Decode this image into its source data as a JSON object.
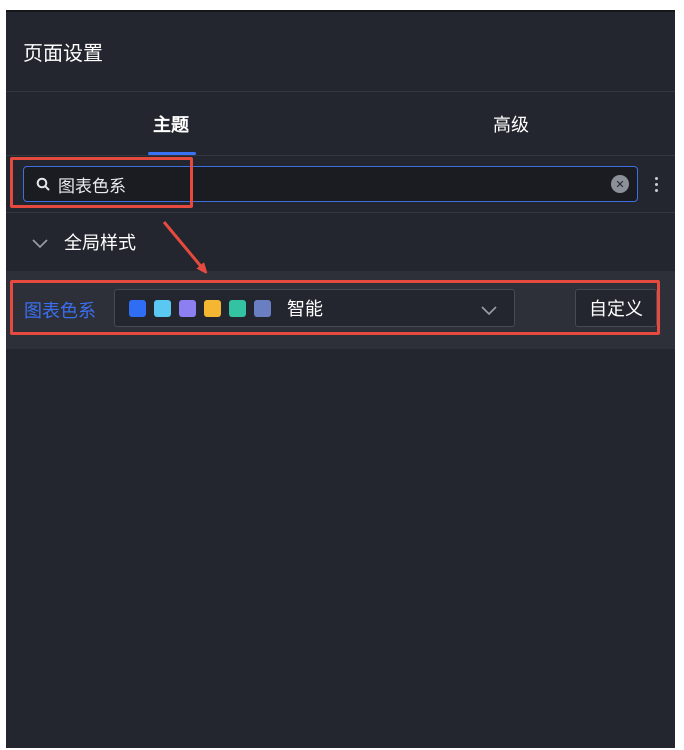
{
  "panel": {
    "title": "页面设置"
  },
  "tabs": [
    {
      "label": "主题",
      "active": true
    },
    {
      "label": "高级",
      "active": false
    }
  ],
  "search": {
    "value": "图表色系",
    "clear_icon": "close-icon",
    "more_icon": "vertical-ellipsis-icon"
  },
  "group": {
    "title": "全局样式",
    "expanded": true
  },
  "setting": {
    "label": "图表色系",
    "palette": {
      "name": "智能",
      "swatches": [
        "#2f6df5",
        "#5ac8f0",
        "#8b7ff2",
        "#f5b731",
        "#34c3a2",
        "#6a7ec2"
      ]
    },
    "custom_button": "自定义"
  },
  "colors": {
    "accent": "#3a72f5",
    "annotation": "#e64a3e",
    "panel_bg": "#23262e"
  }
}
